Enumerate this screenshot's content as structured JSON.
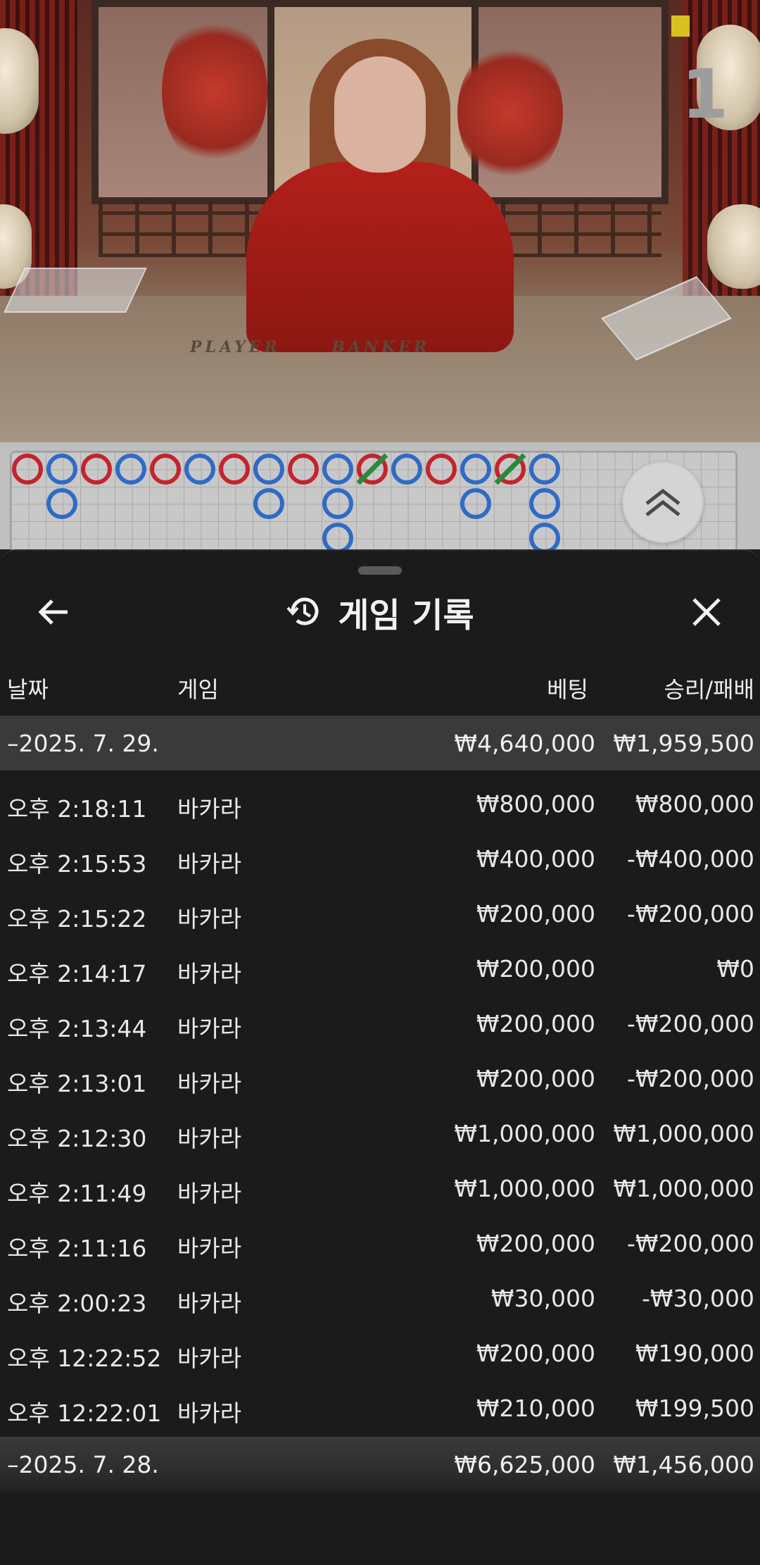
{
  "video": {
    "round_number": "1",
    "table_labels": [
      "PLAYER",
      "BANKER"
    ]
  },
  "roadmap": {
    "colors": {
      "player": "#2f6bc6",
      "banker": "#c4242b",
      "tie": "#2a8a3a"
    }
  },
  "panel": {
    "title": "게임 기록",
    "icons": {
      "back": "arrow-left-icon",
      "history": "history-icon",
      "close": "close-icon",
      "expand": "chevron-double-up-icon"
    },
    "columns": {
      "date": "날짜",
      "game": "게임",
      "bet": "베팅",
      "result": "승리/패배"
    },
    "days": [
      {
        "date": "–2025. 7. 29.",
        "bet": "₩4,640,000",
        "result": "₩1,959,500",
        "rows": [
          {
            "time": "오후 2:18:11",
            "game": "바카라",
            "bet": "₩800,000",
            "result": "₩800,000"
          },
          {
            "time": "오후 2:15:53",
            "game": "바카라",
            "bet": "₩400,000",
            "result": "-₩400,000"
          },
          {
            "time": "오후 2:15:22",
            "game": "바카라",
            "bet": "₩200,000",
            "result": "-₩200,000"
          },
          {
            "time": "오후 2:14:17",
            "game": "바카라",
            "bet": "₩200,000",
            "result": "₩0"
          },
          {
            "time": "오후 2:13:44",
            "game": "바카라",
            "bet": "₩200,000",
            "result": "-₩200,000"
          },
          {
            "time": "오후 2:13:01",
            "game": "바카라",
            "bet": "₩200,000",
            "result": "-₩200,000"
          },
          {
            "time": "오후 2:12:30",
            "game": "바카라",
            "bet": "₩1,000,000",
            "result": "₩1,000,000"
          },
          {
            "time": "오후 2:11:49",
            "game": "바카라",
            "bet": "₩1,000,000",
            "result": "₩1,000,000"
          },
          {
            "time": "오후 2:11:16",
            "game": "바카라",
            "bet": "₩200,000",
            "result": "-₩200,000"
          },
          {
            "time": "오후 2:00:23",
            "game": "바카라",
            "bet": "₩30,000",
            "result": "-₩30,000"
          },
          {
            "time": "오후 12:22:52",
            "game": "바카라",
            "bet": "₩200,000",
            "result": "₩190,000"
          },
          {
            "time": "오후 12:22:01",
            "game": "바카라",
            "bet": "₩210,000",
            "result": "₩199,500"
          }
        ]
      },
      {
        "date": "–2025. 7. 28.",
        "bet": "₩6,625,000",
        "result": "₩1,456,000",
        "rows": []
      }
    ]
  }
}
